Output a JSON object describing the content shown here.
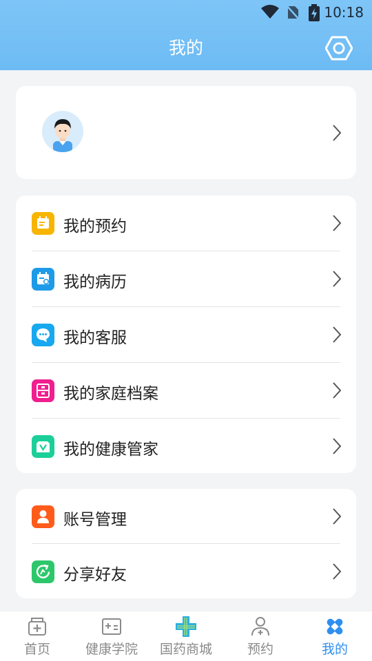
{
  "status_bar": {
    "time": "10:18"
  },
  "header": {
    "title": "我的"
  },
  "menu_main": [
    {
      "label": "我的预约",
      "icon": "calendar-icon",
      "color": "#f7b500"
    },
    {
      "label": "我的病历",
      "icon": "medical-record-icon",
      "color": "#1e9be8"
    },
    {
      "label": "我的客服",
      "icon": "chat-icon",
      "color": "#18a8f0"
    },
    {
      "label": "我的家庭档案",
      "icon": "family-file-icon",
      "color": "#f01e8e"
    },
    {
      "label": "我的健康管家",
      "icon": "health-kit-icon",
      "color": "#1ccf9a"
    }
  ],
  "menu_account": [
    {
      "label": "账号管理",
      "icon": "user-icon",
      "color": "#ff5b1a"
    },
    {
      "label": "分享好友",
      "icon": "share-icon",
      "color": "#2dc76b"
    }
  ],
  "tabbar": [
    {
      "label": "首页",
      "icon": "home-kit-icon",
      "active": false
    },
    {
      "label": "健康学院",
      "icon": "academy-icon",
      "active": false
    },
    {
      "label": "国药商城",
      "icon": "pharmacy-cross-icon",
      "active": false
    },
    {
      "label": "预约",
      "icon": "doctor-icon",
      "active": false
    },
    {
      "label": "我的",
      "icon": "bandage-icon",
      "active": true
    }
  ],
  "colors": {
    "header": "#7ec5f7",
    "accent": "#2f8ff0"
  }
}
